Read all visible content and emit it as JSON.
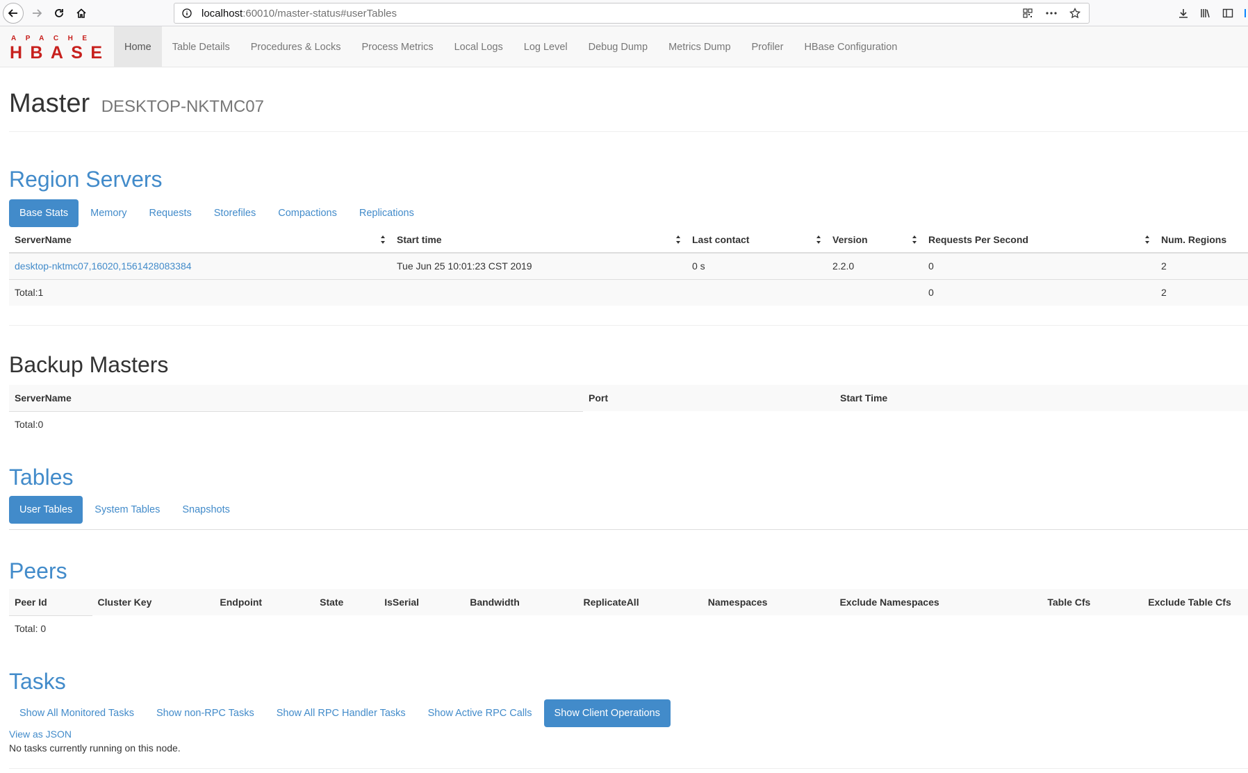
{
  "browser": {
    "url_host": "localhost",
    "url_path": ":60010/master-status#userTables"
  },
  "nav": {
    "items": [
      "Home",
      "Table Details",
      "Procedures & Locks",
      "Process Metrics",
      "Local Logs",
      "Log Level",
      "Debug Dump",
      "Metrics Dump",
      "Profiler",
      "HBase Configuration"
    ],
    "active": "Home"
  },
  "logo": {
    "top": "APACHE",
    "bottom": "HBASE",
    "color": "#c7201d"
  },
  "page": {
    "title": "Master",
    "subtitle": "DESKTOP-NKTMC07"
  },
  "region_servers": {
    "heading": "Region Servers",
    "tabs": [
      "Base Stats",
      "Memory",
      "Requests",
      "Storefiles",
      "Compactions",
      "Replications"
    ],
    "active_tab": "Base Stats",
    "columns": [
      "ServerName",
      "Start time",
      "Last contact",
      "Version",
      "Requests Per Second",
      "Num. Regions"
    ],
    "rows": [
      {
        "server": "desktop-nktmc07,16020,1561428083384",
        "start": "Tue Jun 25 10:01:23 CST 2019",
        "last_contact": "0 s",
        "version": "2.2.0",
        "rps": "0",
        "regions": "2"
      }
    ],
    "total": {
      "label": "Total:1",
      "rps": "0",
      "regions": "2"
    }
  },
  "backup_masters": {
    "heading": "Backup Masters",
    "columns": [
      "ServerName",
      "Port",
      "Start Time"
    ],
    "total": "Total:0"
  },
  "tables": {
    "heading": "Tables",
    "tabs": [
      "User Tables",
      "System Tables",
      "Snapshots"
    ],
    "active_tab": "User Tables"
  },
  "peers": {
    "heading": "Peers",
    "columns": [
      "Peer Id",
      "Cluster Key",
      "Endpoint",
      "State",
      "IsSerial",
      "Bandwidth",
      "ReplicateAll",
      "Namespaces",
      "Exclude Namespaces",
      "Table Cfs",
      "Exclude Table Cfs"
    ],
    "total": "Total: 0"
  },
  "tasks": {
    "heading": "Tasks",
    "tabs": [
      "Show All Monitored Tasks",
      "Show non-RPC Tasks",
      "Show All RPC Handler Tasks",
      "Show Active RPC Calls",
      "Show Client Operations"
    ],
    "active_tab": "Show Client Operations",
    "view_json": "View as JSON",
    "status": "No tasks currently running on this node."
  },
  "colors": {
    "link": "#428bca",
    "navbar_bg": "#f8f8f8"
  }
}
